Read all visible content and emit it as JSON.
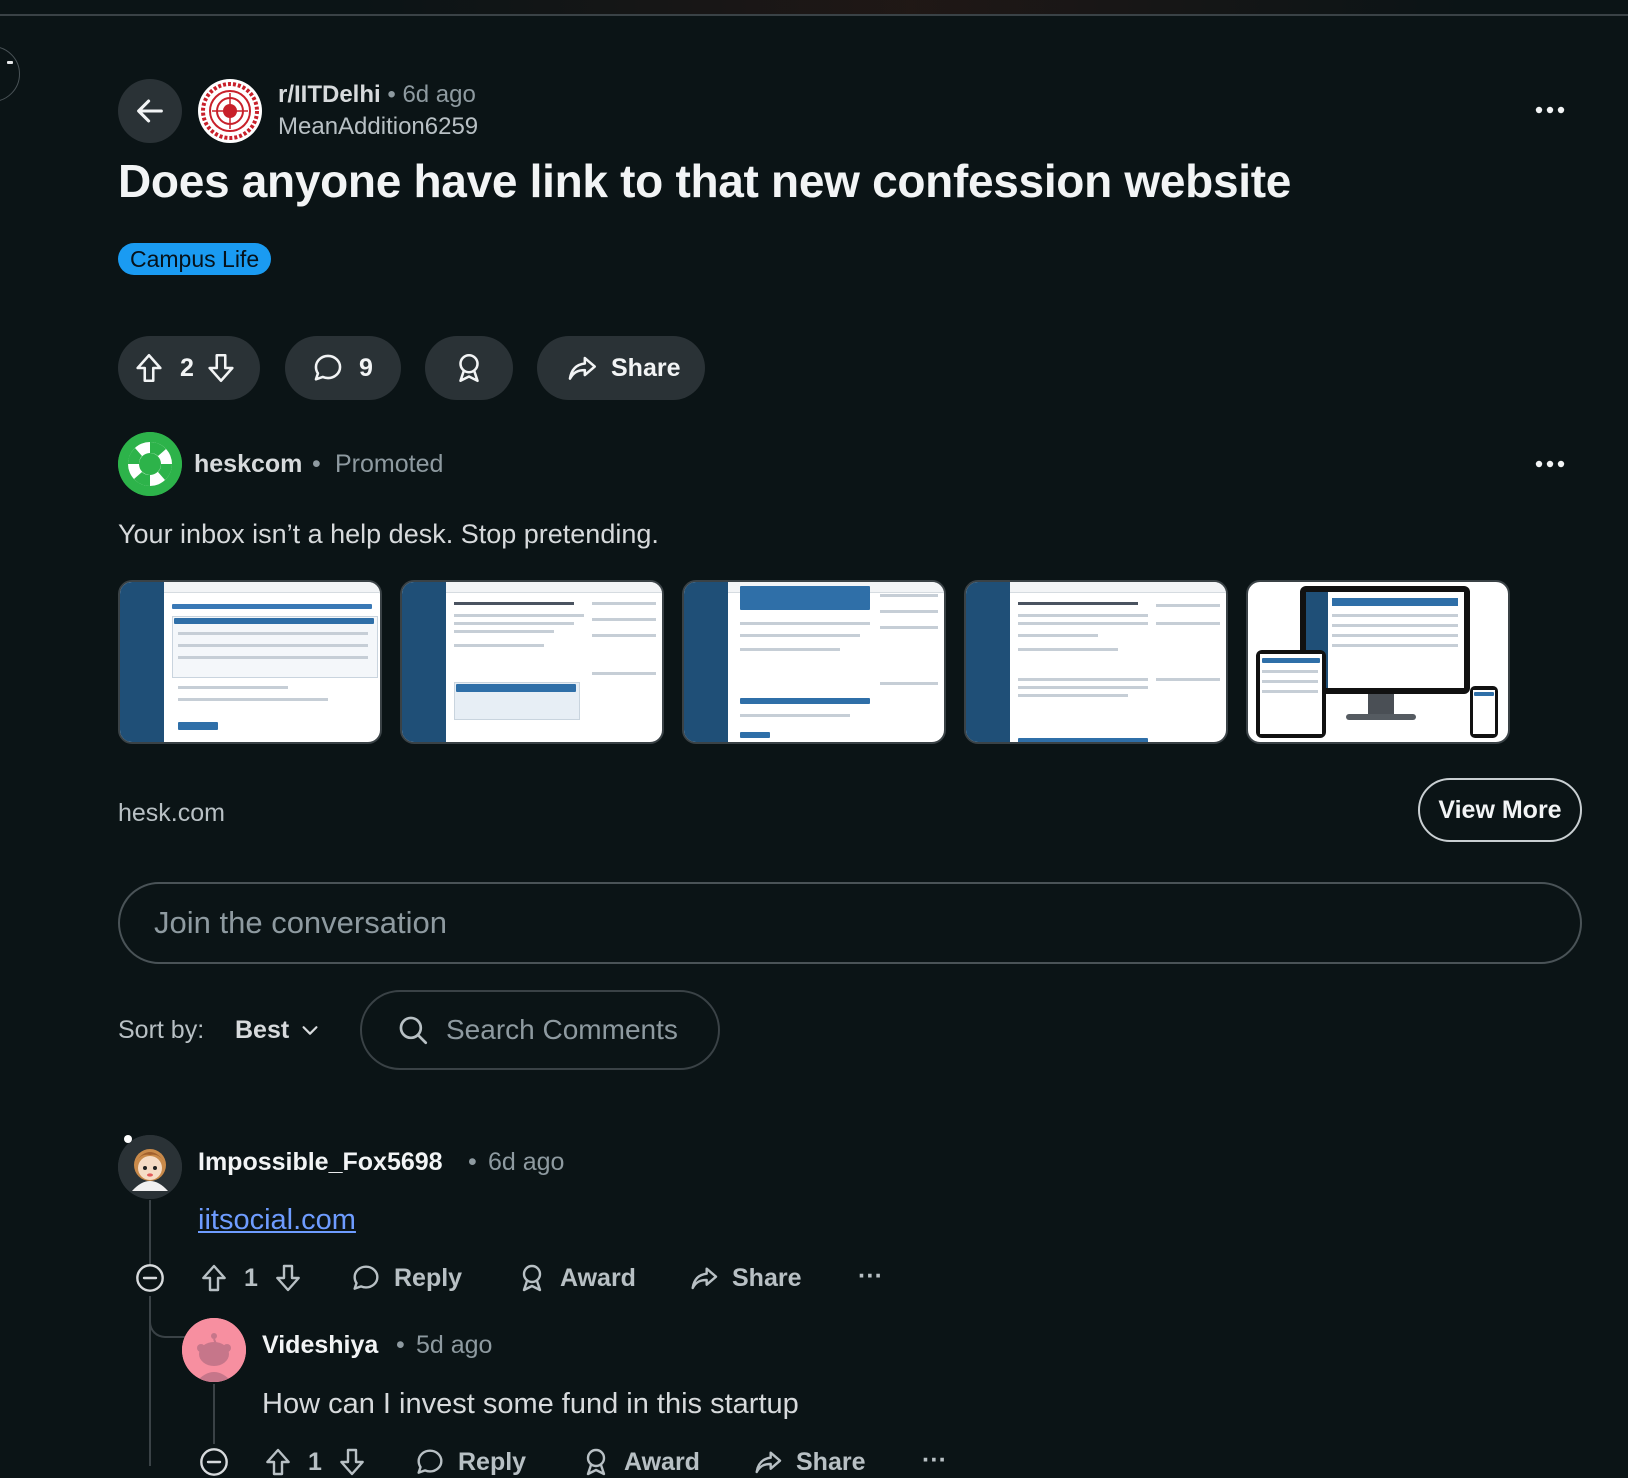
{
  "post": {
    "subreddit": "r/IITDelhi",
    "age": "6d ago",
    "separator": "•",
    "author": "MeanAddition6259",
    "title": "Does anyone have link to that new confession website",
    "flair": "Campus Life",
    "flair_color": "#1a9bf2",
    "votes": "2",
    "comments": "9",
    "share_label": "Share"
  },
  "ad": {
    "advertiser": "heskcom",
    "separator": "•",
    "promoted": "Promoted",
    "headline": "Your inbox isn’t a help desk. Stop pretending.",
    "domain": "hesk.com",
    "cta": "View More",
    "thumbnail_count": 5
  },
  "composer": {
    "placeholder": "Join the conversation"
  },
  "sort": {
    "label": "Sort by:",
    "value": "Best"
  },
  "search": {
    "placeholder": "Search Comments"
  },
  "comments": [
    {
      "author": "Impossible_Fox5698",
      "age": "6d ago",
      "separator": "•",
      "link_text": "iitsocial.com",
      "votes": "1",
      "reply_label": "Reply",
      "award_label": "Award",
      "share_label": "Share",
      "more": "···"
    },
    {
      "author": "Videshiya",
      "age": "5d ago",
      "separator": "•",
      "text": "How can I invest some fund in this startup",
      "votes": "1",
      "reply_label": "Reply",
      "award_label": "Award",
      "share_label": "Share",
      "more": "···"
    }
  ],
  "colors": {
    "background": "#0b1416",
    "pill": "#2a3236",
    "link": "#6e9cff",
    "muted": "#8e9aa0"
  }
}
